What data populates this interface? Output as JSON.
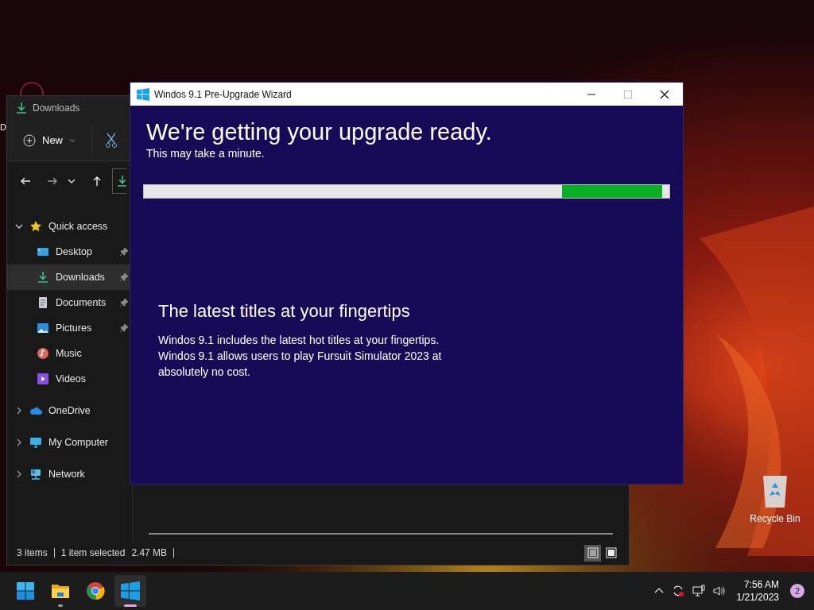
{
  "desktop": {
    "cut_label": "D",
    "icons": [
      {
        "label": "Recycle Bin"
      }
    ]
  },
  "explorer": {
    "title": "Downloads",
    "toolbar": {
      "new_label": "New"
    },
    "tree": [
      {
        "label": "Quick access",
        "kind": "star",
        "expanded": true,
        "children": [
          {
            "label": "Desktop",
            "kind": "desktop",
            "pinned": true,
            "selected": false
          },
          {
            "label": "Downloads",
            "kind": "download",
            "pinned": true,
            "selected": true
          },
          {
            "label": "Documents",
            "kind": "document",
            "pinned": true,
            "selected": false
          },
          {
            "label": "Pictures",
            "kind": "picture",
            "pinned": true,
            "selected": false
          },
          {
            "label": "Music",
            "kind": "music",
            "pinned": false,
            "selected": false
          },
          {
            "label": "Videos",
            "kind": "video",
            "pinned": false,
            "selected": false
          }
        ]
      },
      {
        "label": "OneDrive",
        "kind": "cloud",
        "expanded": false
      },
      {
        "label": "My Computer",
        "kind": "monitor",
        "expanded": false
      },
      {
        "label": "Network",
        "kind": "network",
        "expanded": false
      }
    ],
    "status": {
      "items": "3 items",
      "selection": "1 item selected",
      "size": "2.47 MB"
    },
    "views": [
      {
        "kind": "details",
        "selected": true
      },
      {
        "kind": "tiles",
        "selected": false
      }
    ]
  },
  "wizard": {
    "title": "Windos 9.1 Pre-Upgrade Wizard",
    "heading": "We're getting your upgrade ready.",
    "subheading": "This may take a minute.",
    "progress": {
      "kind": "marquee"
    },
    "feature_title": "The latest titles at your fingertips",
    "feature_text": [
      "Windos 9.1 includes the latest hot titles at your fingertips.",
      "Windos 9.1 allows users to play Fursuit Simulator 2023 at absolutely no cost."
    ]
  },
  "taskbar": {
    "apps": [
      {
        "kind": "start",
        "running": false,
        "active": false
      },
      {
        "kind": "explorer",
        "running": true,
        "active": false
      },
      {
        "kind": "browser",
        "running": false,
        "active": false
      },
      {
        "kind": "wizard",
        "running": true,
        "active": true
      }
    ],
    "time": "7:56 AM",
    "date": "1/21/2023",
    "notifications": "2"
  }
}
